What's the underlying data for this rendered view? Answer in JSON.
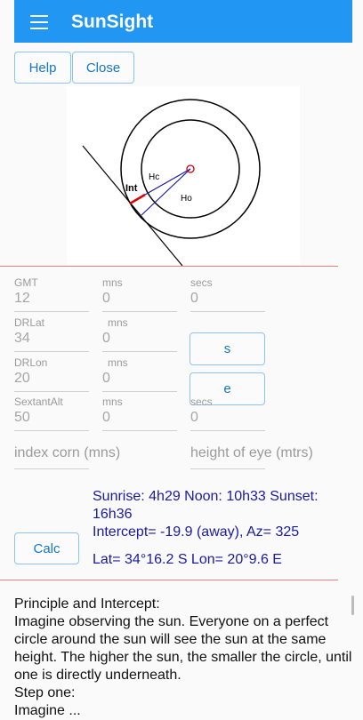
{
  "app": {
    "title": "SunSight"
  },
  "buttons": {
    "help": "Help",
    "close": "Close",
    "s": "s",
    "e": "e",
    "calc": "Calc"
  },
  "diagram": {
    "label_int": "Int",
    "label_hc": "Hc",
    "label_ho": "Ho"
  },
  "form": {
    "gmt": {
      "label": "GMT",
      "value": "12"
    },
    "gmt_mns": {
      "label": "mns",
      "value": "0"
    },
    "gmt_secs": {
      "label": "secs",
      "value": "0"
    },
    "drlat": {
      "label": "DRLat",
      "value": "34"
    },
    "drlat_mns": {
      "label": "mns",
      "value": "0"
    },
    "drlon": {
      "label": "DRLon",
      "value": "20"
    },
    "drlon_mns": {
      "label": "mns",
      "value": "0"
    },
    "sextant": {
      "label": "SextantAlt",
      "value": "50"
    },
    "sextant_mns": {
      "label": "mns",
      "value": "0"
    },
    "sextant_secs": {
      "label": "secs",
      "value": "0"
    },
    "index_corn_placeholder": "index corn (mns)",
    "height_eye_placeholder": "height of eye (mtrs)"
  },
  "results": {
    "sun_line1": "Sunrise: 4h29 Noon: 10h33 Sunset:",
    "sun_line2": "16h36",
    "intercept": "Intercept= -19.9 (away), Az= 325",
    "position": "Lat= 34°16.2 S Lon= 20°9.6 E"
  },
  "explanation": {
    "heading": "Principle and Intercept:",
    "paragraph": "Imagine observing the sun. Everyone on a perfect circle around the sun will see the sun at the same height. The higher the sun, the smaller the circle, until one is directly underneath.",
    "step": "Step one:",
    "cut_line": "Imagine ..."
  },
  "colors": {
    "appbar": "#2196f3",
    "accent_line": "#e88080",
    "result_text": "#1a1aa0",
    "button_text": "#1677c8"
  }
}
